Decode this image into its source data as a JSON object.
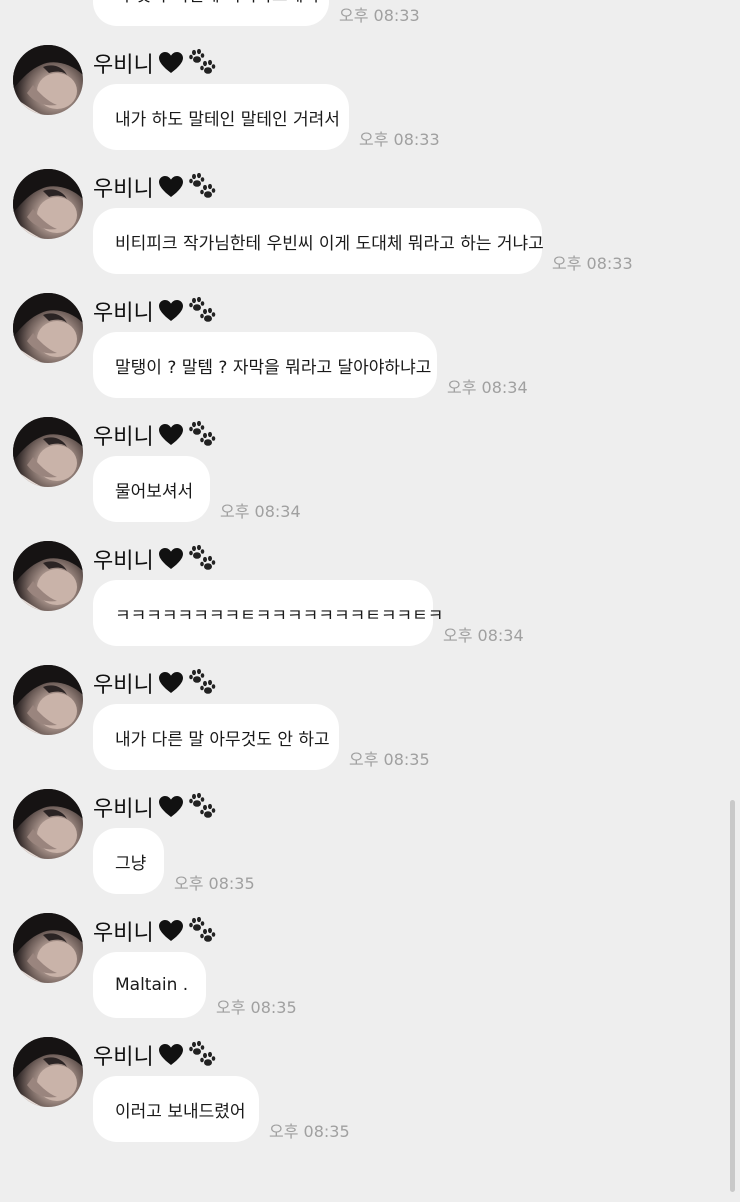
{
  "messages": [
    {
      "sender": "",
      "text": "아 맞아 이번에 비티파크에서",
      "time": "오후 08:33"
    },
    {
      "sender": "우비니",
      "text": "내가 하도 말테인 말테인 거려서",
      "time": "오후 08:33"
    },
    {
      "sender": "우비니",
      "text": "비티피크 작가님한테 우빈씨 이게 도대체 뭐라고 하는 거냐고",
      "time": "오후 08:33"
    },
    {
      "sender": "우비니",
      "text": "말탱이 ? 말템 ? 자막을 뭐라고 달아야하냐고",
      "time": "오후 08:34"
    },
    {
      "sender": "우비니",
      "text": "물어보셔서",
      "time": "오후 08:34"
    },
    {
      "sender": "우비니",
      "text": "ㅋㅋㅋㅋㅋㅋㅋㅋㅌㅋㅋㅋㅋㅋㅋㅋㅌㅋㅋㅌㅋ",
      "time": "오후 08:34"
    },
    {
      "sender": "우비니",
      "text": "내가 다른 말 아무것도 안 하고",
      "time": "오후 08:35"
    },
    {
      "sender": "우비니",
      "text": "그냥",
      "time": "오후 08:35"
    },
    {
      "sender": "우비니",
      "text": "Maltain .",
      "time": "오후 08:35"
    },
    {
      "sender": "우비니",
      "text": "이러고 보내드렸어",
      "time": "오후 08:35"
    }
  ],
  "icons": {
    "heart": "black-heart-icon",
    "paw": "paw-prints-icon"
  },
  "colors": {
    "background": "#eeeeee",
    "bubble": "#ffffff",
    "timestamp": "#a0a0a0"
  }
}
